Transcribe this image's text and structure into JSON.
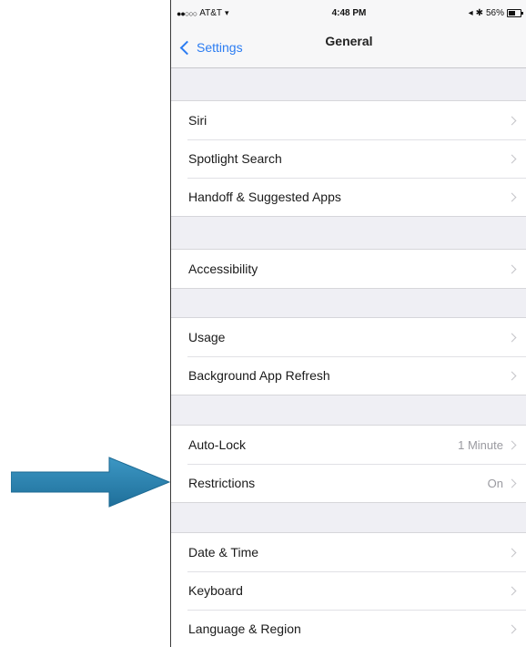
{
  "status_bar": {
    "signal": "●●○○○",
    "carrier": "AT&T",
    "wifi_icon": "wifi-icon",
    "time": "4:48 PM",
    "location_icon": "◂",
    "bluetooth_icon": "✱",
    "battery_percent": "56%"
  },
  "nav": {
    "back_label": "Settings",
    "title": "General"
  },
  "groups": [
    {
      "rows": [
        {
          "label": "Siri",
          "value": ""
        },
        {
          "label": "Spotlight Search",
          "value": ""
        },
        {
          "label": "Handoff & Suggested Apps",
          "value": ""
        }
      ]
    },
    {
      "rows": [
        {
          "label": "Accessibility",
          "value": ""
        }
      ]
    },
    {
      "rows": [
        {
          "label": "Usage",
          "value": ""
        },
        {
          "label": "Background App Refresh",
          "value": ""
        }
      ]
    },
    {
      "rows": [
        {
          "label": "Auto-Lock",
          "value": "1 Minute"
        },
        {
          "label": "Restrictions",
          "value": "On"
        }
      ]
    },
    {
      "rows": [
        {
          "label": "Date & Time",
          "value": ""
        },
        {
          "label": "Keyboard",
          "value": ""
        },
        {
          "label": "Language & Region",
          "value": ""
        }
      ]
    }
  ],
  "annotation": {
    "arrow_color": "#2a86b5",
    "points_to": "Restrictions"
  },
  "colors": {
    "accent": "#2b7cf2",
    "grouped_background": "#efeff4"
  }
}
